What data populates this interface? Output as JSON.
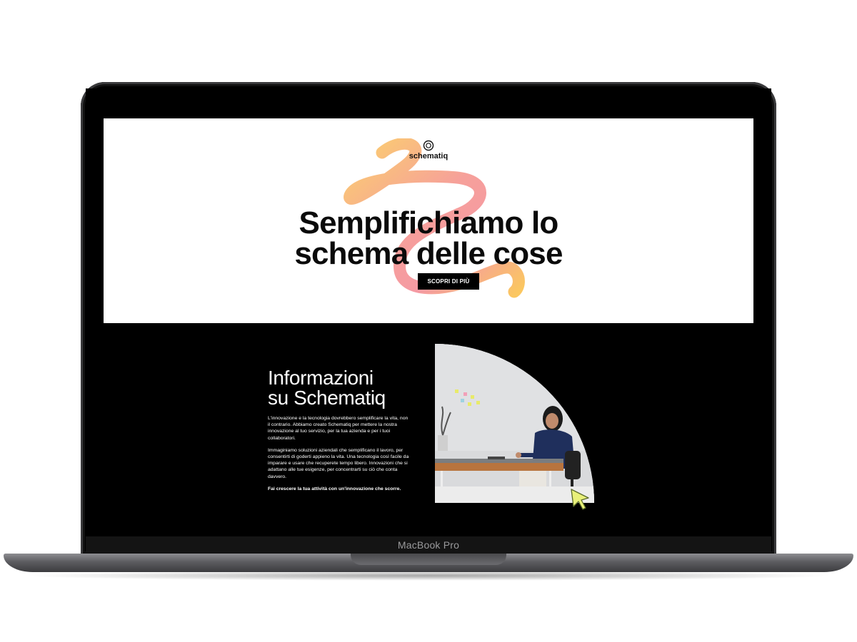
{
  "device": {
    "label": "MacBook Pro"
  },
  "site": {
    "logo_text": "schematiq",
    "hero": {
      "title_line1": "Semplifichiamo lo",
      "title_line2": "schema delle cose",
      "cta_label": "SCOPRI DI PIÙ"
    },
    "about": {
      "title_line1": "Informazioni",
      "title_line2": "su Schematiq",
      "paragraph1": "L'innovazione e la tecnologia dovrebbero semplificare la vita, non il contrario. Abbiamo creato Schematiq per mettere la nostra innovazione al tuo servizio, per la tua azienda e per i tuoi collaboratori.",
      "paragraph2": "Immaginiamo soluzioni aziendali che semplificano il lavoro, per consentirti di goderti appieno la vita. Una tecnologia così facile da imparare e usare che recuperete tempo libero. Innovazioni che si adattano alle tue esigenze, per concentrarti su ciò che conta davvero.",
      "paragraph3": "Fai crescere la tua attività con un'innovazione che scorre."
    }
  },
  "icons": {
    "logo": "schematiq-logo-icon",
    "cursor": "pointer-cursor-icon",
    "decoration": "gradient-squiggle"
  },
  "colors": {
    "screen_bg": "#000000",
    "hero_bg": "#ffffff",
    "cta_bg": "#000000",
    "squiggle_yellow": "#f9c86a",
    "squiggle_pink": "#f597a3",
    "cursor_fill": "#e9f07a"
  }
}
